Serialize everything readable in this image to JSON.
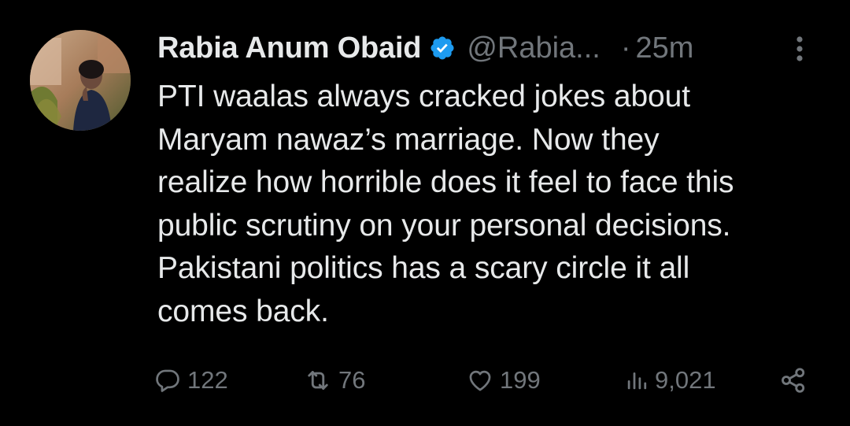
{
  "tweet": {
    "author": {
      "display_name": "Rabia Anum Obaid",
      "verified_icon": "verified-badge-icon",
      "handle": "@Rabia...",
      "avatar_icon": "profile-avatar"
    },
    "separator": "·",
    "time": "25m",
    "text_lines": [
      "PTI waalas always cracked jokes about",
      "Maryam nawaz’s marriage. Now they",
      "realize how horrible does it feel to face this",
      "public scrutiny on your personal decisions.",
      "Pakistani politics has a scary circle it all",
      "comes back."
    ],
    "stats": {
      "replies": "122",
      "retweets": "76",
      "likes": "199",
      "views": "9,021"
    },
    "icons": {
      "reply": "reply-icon",
      "retweet": "retweet-icon",
      "like": "heart-icon",
      "views": "views-bar-chart-icon",
      "share": "share-icon",
      "more": "more-vertical-icon"
    },
    "colors": {
      "background": "#000000",
      "text": "#e7e9ea",
      "muted": "#71767b",
      "verified": "#1d9bf0"
    }
  }
}
